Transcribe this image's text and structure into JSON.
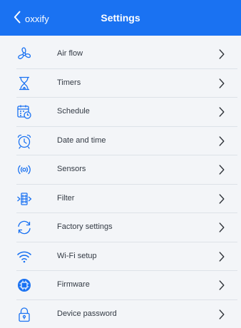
{
  "app": {
    "brand_color": "#1a72f2",
    "icon_color": "#1a72f2",
    "background": "#f3f5f8"
  },
  "header": {
    "back_label": "oxxify",
    "title": "Settings"
  },
  "menu": {
    "items": [
      {
        "label": "Air flow",
        "icon": "fan-icon"
      },
      {
        "label": "Timers",
        "icon": "hourglass-icon"
      },
      {
        "label": "Schedule",
        "icon": "calendar-clock-icon"
      },
      {
        "label": "Date and time",
        "icon": "alarm-clock-icon"
      },
      {
        "label": "Sensors",
        "icon": "sensor-waves-icon"
      },
      {
        "label": "Filter",
        "icon": "filter-icon"
      },
      {
        "label": "Factory settings",
        "icon": "refresh-icon"
      },
      {
        "label": "Wi-Fi setup",
        "icon": "wifi-icon"
      },
      {
        "label": "Firmware",
        "icon": "chip-icon"
      },
      {
        "label": "Device password",
        "icon": "lock-icon"
      }
    ]
  }
}
